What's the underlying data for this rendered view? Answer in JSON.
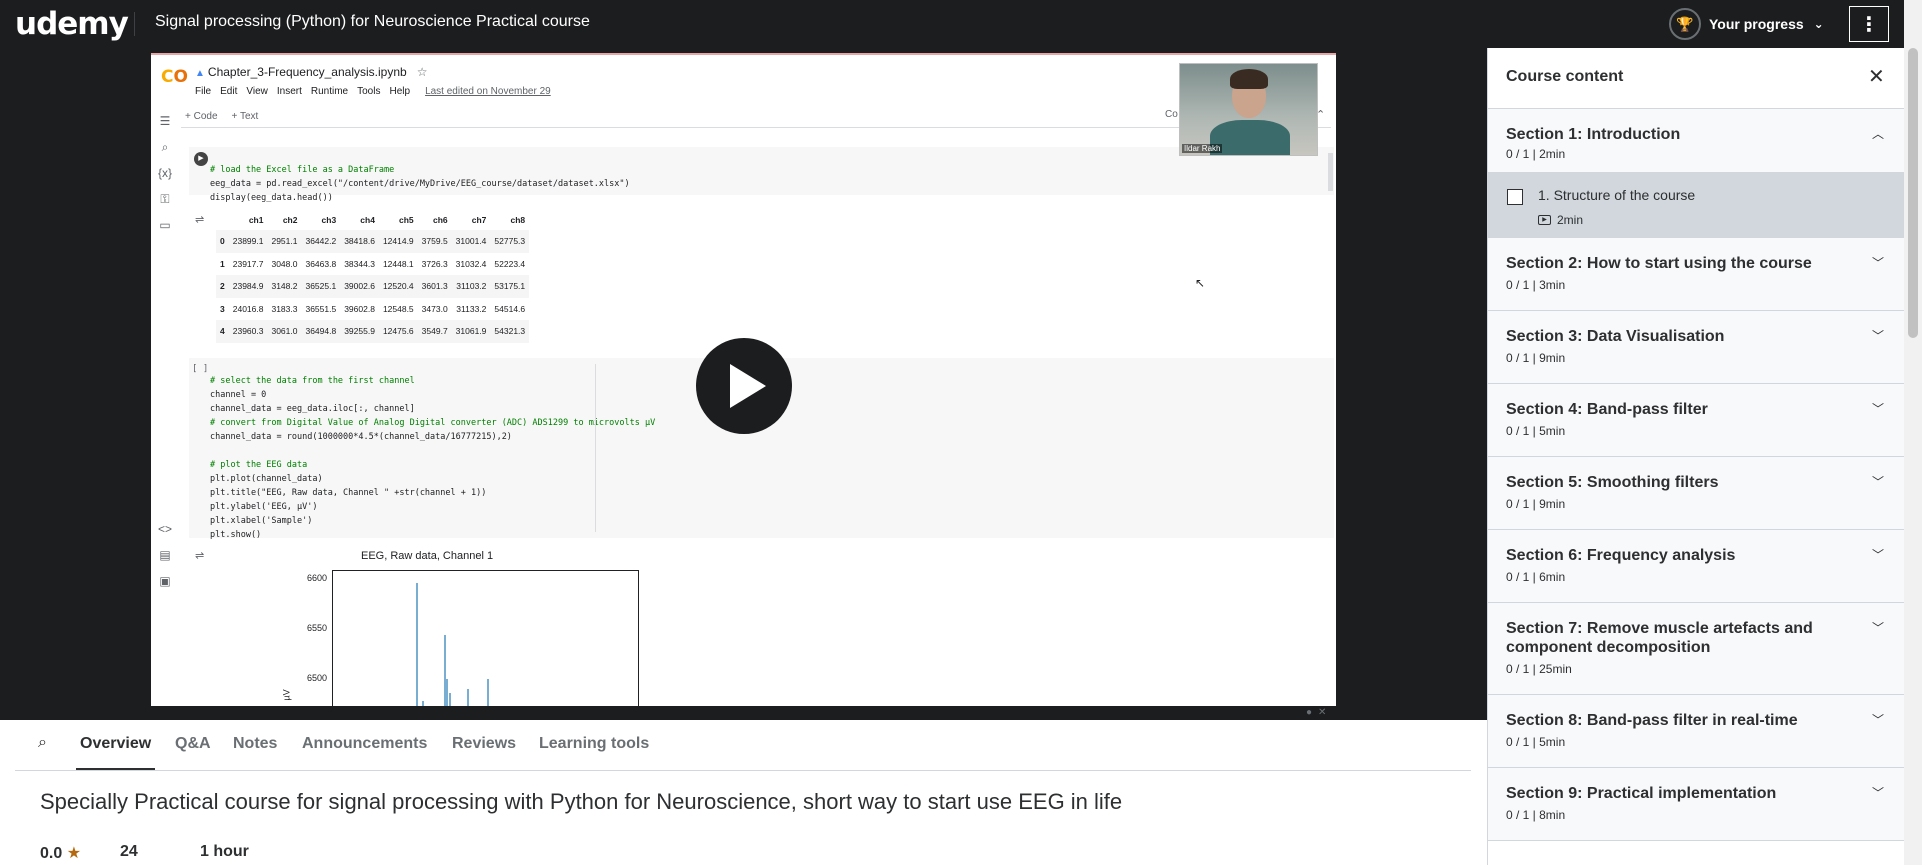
{
  "header": {
    "logo": "udemy",
    "course_title": "Signal processing (Python) for Neuroscience Practical course",
    "progress_label": "Your progress",
    "more_icon": "more-vertical-icon"
  },
  "notebook": {
    "filename": "Chapter_3-Frequency_analysis.ipynb",
    "menu": [
      "File",
      "Edit",
      "View",
      "Insert",
      "Runtime",
      "Tools",
      "Help"
    ],
    "last_edited": "Last edited on November 29",
    "add_code": "+ Code",
    "add_text": "+ Text",
    "connect_partial": "Co",
    "cell1_code": [
      "# load the Excel file as a DataFrame",
      "eeg_data = pd.read_excel(\"/content/drive/MyDrive/EEG_course/dataset/dataset.xlsx\")",
      "display(eeg_data.head())"
    ],
    "table": {
      "columns": [
        "",
        "ch1",
        "ch2",
        "ch3",
        "ch4",
        "ch5",
        "ch6",
        "ch7",
        "ch8"
      ],
      "rows": [
        [
          "0",
          "23899.1",
          "2951.1",
          "36442.2",
          "38418.6",
          "12414.9",
          "3759.5",
          "31001.4",
          "52775.3"
        ],
        [
          "1",
          "23917.7",
          "3048.0",
          "36463.8",
          "38344.3",
          "12448.1",
          "3726.3",
          "31032.4",
          "52223.4"
        ],
        [
          "2",
          "23984.9",
          "3148.2",
          "36525.1",
          "39002.6",
          "12520.4",
          "3601.3",
          "31103.2",
          "53175.1"
        ],
        [
          "3",
          "24016.8",
          "3183.3",
          "36551.5",
          "39602.8",
          "12548.5",
          "3473.0",
          "31133.2",
          "54514.6"
        ],
        [
          "4",
          "23960.3",
          "3061.0",
          "36494.8",
          "39255.9",
          "12475.6",
          "3549.7",
          "31061.9",
          "54321.3"
        ]
      ]
    },
    "cell2_bracket": "[ ]",
    "cell2_code": [
      "# select the data from the first channel",
      "channel = 0",
      "channel_data = eeg_data.iloc[:, channel]",
      "# convert from Digital Value of Analog Digital converter (ADC) ADS1299 to microvolts µV",
      "channel_data = round(1000000*4.5*(channel_data/16777215),2)",
      "",
      "# plot the EEG data",
      "plt.plot(channel_data)",
      "plt.title(\"EEG, Raw data, Channel \" +str(channel + 1))",
      "plt.ylabel('EEG, µV')",
      "plt.xlabel('Sample')",
      "plt.show()"
    ],
    "plot_title": "EEG, Raw data, Channel 1",
    "plot_yticks": [
      "6600",
      "6550",
      "6500"
    ],
    "plot_ylabel": "µV",
    "webcam_name": "Ildar Rakh"
  },
  "tabs": {
    "search_icon": "search-icon",
    "items": [
      "Overview",
      "Q&A",
      "Notes",
      "Announcements",
      "Reviews",
      "Learning tools"
    ],
    "active": "Overview"
  },
  "overview": {
    "title": "Specially Practical course for signal processing with Python for Neuroscience, short way to start use EEG in life",
    "rating": "0.0",
    "ratings_count": "24",
    "duration": "1 hour"
  },
  "sidebar": {
    "title": "Course content",
    "sections": [
      {
        "title": "Section 1: Introduction",
        "meta": "0 / 1 | 2min",
        "expanded": true
      },
      {
        "title": "Section 2: How to start using the course",
        "meta": "0 / 1 | 3min"
      },
      {
        "title": "Section 3: Data Visualisation",
        "meta": "0 / 1 | 9min"
      },
      {
        "title": "Section 4: Band-pass filter",
        "meta": "0 / 1 | 5min"
      },
      {
        "title": "Section 5: Smoothing filters",
        "meta": "0 / 1 | 9min"
      },
      {
        "title": "Section 6: Frequency analysis",
        "meta": "0 / 1 | 6min"
      },
      {
        "title": "Section 7: Remove muscle artefacts and component decomposition",
        "meta": "0 / 1 | 25min"
      },
      {
        "title": "Section 8: Band-pass filter in real-time",
        "meta": "0 / 1 | 5min"
      },
      {
        "title": "Section 9: Practical implementation",
        "meta": "0 / 1 | 8min"
      }
    ],
    "lecture": {
      "title": "1. Structure of the course",
      "duration": "2min"
    }
  },
  "colors": {
    "brand": "#a435f0",
    "dark": "#1c1d1f",
    "rating_star": "#b4690e"
  }
}
